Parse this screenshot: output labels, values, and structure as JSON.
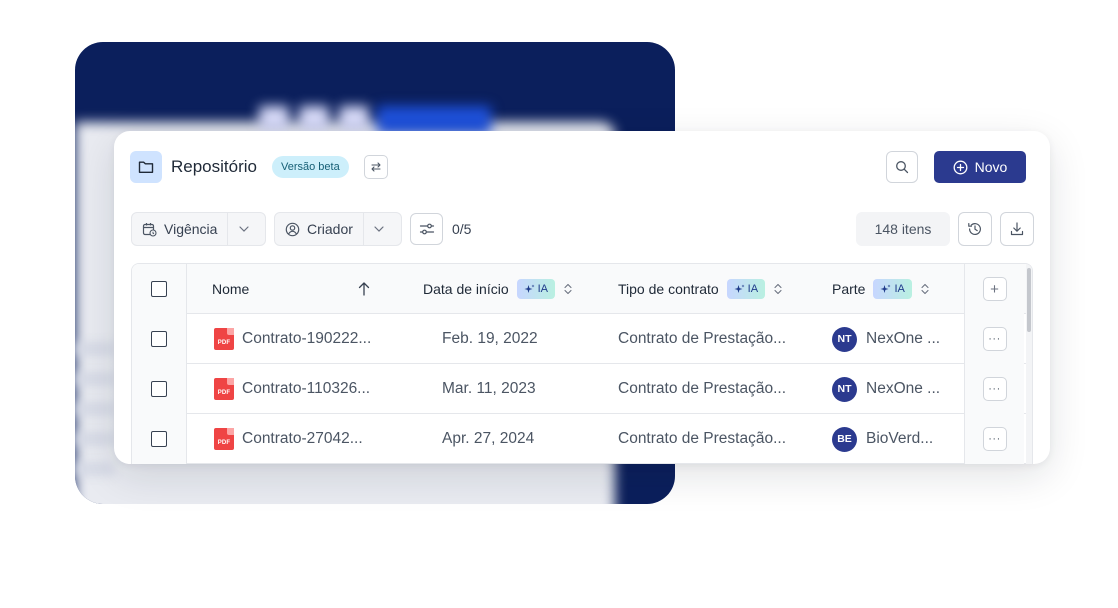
{
  "header": {
    "title": "Repositório",
    "beta_badge": "Versão beta",
    "new_button": "Novo"
  },
  "toolbar": {
    "filter_vigencia": "Vigência",
    "filter_criador": "Criador",
    "filter_count": "0/5",
    "items_count": "148 itens"
  },
  "table": {
    "columns": {
      "nome": "Nome",
      "data_inicio": "Data de início",
      "tipo_contrato": "Tipo de contrato",
      "parte": "Parte",
      "ai_label": "IA"
    },
    "file_badge": "PDF",
    "rows": [
      {
        "name": "Contrato-190222...",
        "date": "Feb. 19, 2022",
        "type": "Contrato de Prestação...",
        "party_initials": "NT",
        "party": "NexOne ..."
      },
      {
        "name": "Contrato-110326...",
        "date": "Mar. 11, 2023",
        "type": "Contrato de Prestação...",
        "party_initials": "NT",
        "party": "NexOne ..."
      },
      {
        "name": "Contrato-27042...",
        "date": "Apr. 27, 2024",
        "type": "Contrato de Prestação...",
        "party_initials": "BE",
        "party": "BioVerd..."
      }
    ]
  },
  "colors": {
    "primary": "#2b3a8f",
    "background_card": "#0b1f5c",
    "beta_badge_bg": "#cdeffb",
    "pdf_red": "#ef4444"
  }
}
